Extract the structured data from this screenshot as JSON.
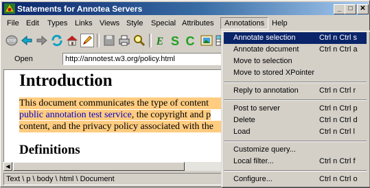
{
  "window": {
    "title": "Statements for Annotea Servers",
    "controls": {
      "minimize": "_",
      "maximize": "□",
      "close": "✕"
    }
  },
  "menubar": {
    "items": [
      {
        "label": "File"
      },
      {
        "label": "Edit"
      },
      {
        "label": "Types"
      },
      {
        "label": "Links"
      },
      {
        "label": "Views"
      },
      {
        "label": "Style"
      },
      {
        "label": "Special"
      },
      {
        "label": "Attributes"
      },
      {
        "label": "Annotations"
      },
      {
        "label": "Help"
      }
    ],
    "open_menu": "Annotations"
  },
  "toolbar": {
    "icons": [
      "stop-icon",
      "back-arrow-icon",
      "forward-arrow-icon",
      "reload-icon",
      "home-icon",
      "edit-pencil-icon",
      "save-icon",
      "print-icon",
      "find-icon",
      "emphasis-icon",
      "strong-icon",
      "code-icon",
      "image-icon",
      "table-icon"
    ]
  },
  "address": {
    "label": "Open",
    "value": "http://annotest.w3.org/policy.html"
  },
  "document": {
    "heading": "Introduction",
    "para_line1": "This document communicates the type of content",
    "para_line2_link": "public annotation test service",
    "para_line2_rest": ", the copyright and p",
    "para_line3": "content, and the privacy policy associated with the",
    "subheading": "Definitions"
  },
  "statusbar": {
    "path": "Text \\ p \\ body \\ html \\ Document"
  },
  "annotations_menu": {
    "items": [
      {
        "label": "Annotate selection",
        "accel": "Ctrl n Ctrl s",
        "selected": true
      },
      {
        "label": "Annotate document",
        "accel": "Ctrl n Ctrl a"
      },
      {
        "label": "Move to selection",
        "accel": ""
      },
      {
        "label": "Move to stored XPointer",
        "accel": ""
      },
      {
        "label": "Reply to annotation",
        "accel": "Ctrl n Ctrl r"
      },
      {
        "label": "Post to server",
        "accel": "Ctrl n Ctrl p"
      },
      {
        "label": "Delete",
        "accel": "Ctrl n Ctrl d"
      },
      {
        "label": "Load",
        "accel": "Ctrl n Ctrl l"
      },
      {
        "label": "Customize query...",
        "accel": ""
      },
      {
        "label": "Local filter...",
        "accel": "Ctrl n Ctrl f"
      },
      {
        "label": "Configure...",
        "accel": "Ctrl n Ctrl o"
      }
    ]
  },
  "colors": {
    "title_gradient_start": "#0a246a",
    "selection": "#0a246a",
    "highlight": "#ffcc80",
    "link": "#0000c8"
  }
}
